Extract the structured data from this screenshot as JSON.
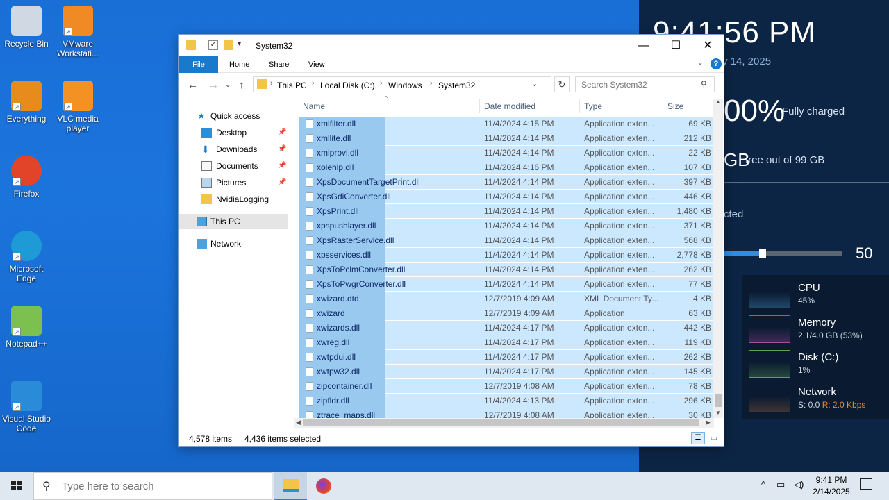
{
  "desktop_icons": [
    {
      "label": "Recycle Bin",
      "icon": "recycle-bin-icon"
    },
    {
      "label": "VMware Workstati...",
      "icon": "vmware-icon"
    },
    {
      "label": "Everything",
      "icon": "everything-search-icon"
    },
    {
      "label": "VLC media player",
      "icon": "vlc-icon"
    },
    {
      "label": "Firefox",
      "icon": "firefox-icon"
    },
    {
      "label": "Microsoft Edge",
      "icon": "edge-icon"
    },
    {
      "label": "Notepad++",
      "icon": "notepadpp-icon"
    },
    {
      "label": "Visual Studio Code",
      "icon": "vscode-icon"
    }
  ],
  "side_panel": {
    "time": "9:41:56 PM",
    "date": "y 14, 2025",
    "battery_pct": "00%",
    "battery_status": "Fully charged",
    "disk_gb": "GB",
    "disk_free": "free out of 99 GB",
    "connection": "cted",
    "volume": "50",
    "volume_level": 0.33,
    "perf": [
      {
        "title": "CPU",
        "sub": "45%",
        "color": "#4aa3df"
      },
      {
        "title": "Memory",
        "sub": "2.1/4.0 GB (53%)",
        "color": "#a34fa8"
      },
      {
        "title": "Disk (C:)",
        "sub": "1%",
        "color": "#5aa34f"
      },
      {
        "title": "Network",
        "sub_s": "S: 0.0",
        "sub_r": "R: 2.0 Kbps",
        "color": "#a8673a"
      }
    ]
  },
  "explorer": {
    "title": "System32",
    "ribbon": {
      "file": "File",
      "home": "Home",
      "share": "Share",
      "view": "View"
    },
    "breadcrumb": [
      "This PC",
      "Local Disk (C:)",
      "Windows",
      "System32"
    ],
    "search_placeholder": "Search System32",
    "nav": {
      "quick_access": "Quick access",
      "items": [
        "Desktop",
        "Downloads",
        "Documents",
        "Pictures",
        "NvidiaLogging"
      ],
      "this_pc": "This PC",
      "network": "Network"
    },
    "columns": {
      "name": "Name",
      "date": "Date modified",
      "type": "Type",
      "size": "Size"
    },
    "files": [
      {
        "name": "xmlfilter.dll",
        "date": "11/4/2024 4:15 PM",
        "type": "Application exten...",
        "size": "69 KB"
      },
      {
        "name": "xmllite.dll",
        "date": "11/4/2024 4:14 PM",
        "type": "Application exten...",
        "size": "212 KB"
      },
      {
        "name": "xmlprovi.dll",
        "date": "11/4/2024 4:14 PM",
        "type": "Application exten...",
        "size": "22 KB"
      },
      {
        "name": "xolehlp.dll",
        "date": "11/4/2024 4:16 PM",
        "type": "Application exten...",
        "size": "107 KB"
      },
      {
        "name": "XpsDocumentTargetPrint.dll",
        "date": "11/4/2024 4:14 PM",
        "type": "Application exten...",
        "size": "397 KB"
      },
      {
        "name": "XpsGdiConverter.dll",
        "date": "11/4/2024 4:14 PM",
        "type": "Application exten...",
        "size": "446 KB"
      },
      {
        "name": "XpsPrint.dll",
        "date": "11/4/2024 4:14 PM",
        "type": "Application exten...",
        "size": "1,480 KB"
      },
      {
        "name": "xpspushlayer.dll",
        "date": "11/4/2024 4:14 PM",
        "type": "Application exten...",
        "size": "371 KB"
      },
      {
        "name": "XpsRasterService.dll",
        "date": "11/4/2024 4:14 PM",
        "type": "Application exten...",
        "size": "568 KB"
      },
      {
        "name": "xpsservices.dll",
        "date": "11/4/2024 4:14 PM",
        "type": "Application exten...",
        "size": "2,778 KB"
      },
      {
        "name": "XpsToPclmConverter.dll",
        "date": "11/4/2024 4:14 PM",
        "type": "Application exten...",
        "size": "262 KB"
      },
      {
        "name": "XpsToPwgrConverter.dll",
        "date": "11/4/2024 4:14 PM",
        "type": "Application exten...",
        "size": "77 KB"
      },
      {
        "name": "xwizard.dtd",
        "date": "12/7/2019 4:09 AM",
        "type": "XML Document Ty...",
        "size": "4 KB"
      },
      {
        "name": "xwizard",
        "date": "12/7/2019 4:09 AM",
        "type": "Application",
        "size": "63 KB"
      },
      {
        "name": "xwizards.dll",
        "date": "11/4/2024 4:17 PM",
        "type": "Application exten...",
        "size": "442 KB"
      },
      {
        "name": "xwreg.dll",
        "date": "11/4/2024 4:17 PM",
        "type": "Application exten...",
        "size": "119 KB"
      },
      {
        "name": "xwtpdui.dll",
        "date": "11/4/2024 4:17 PM",
        "type": "Application exten...",
        "size": "262 KB"
      },
      {
        "name": "xwtpw32.dll",
        "date": "11/4/2024 4:17 PM",
        "type": "Application exten...",
        "size": "145 KB"
      },
      {
        "name": "zipcontainer.dll",
        "date": "12/7/2019 4:08 AM",
        "type": "Application exten...",
        "size": "78 KB"
      },
      {
        "name": "zipfldr.dll",
        "date": "11/4/2024 4:13 PM",
        "type": "Application exten...",
        "size": "296 KB"
      },
      {
        "name": "ztrace_maps.dll",
        "date": "12/7/2019 4:08 AM",
        "type": "Application exten...",
        "size": "30 KB"
      }
    ],
    "status": {
      "items": "4,578 items",
      "selected": "4,436 items selected"
    }
  },
  "taskbar": {
    "search_placeholder": "Type here to search",
    "time": "9:41 PM",
    "date": "2/14/2025"
  }
}
